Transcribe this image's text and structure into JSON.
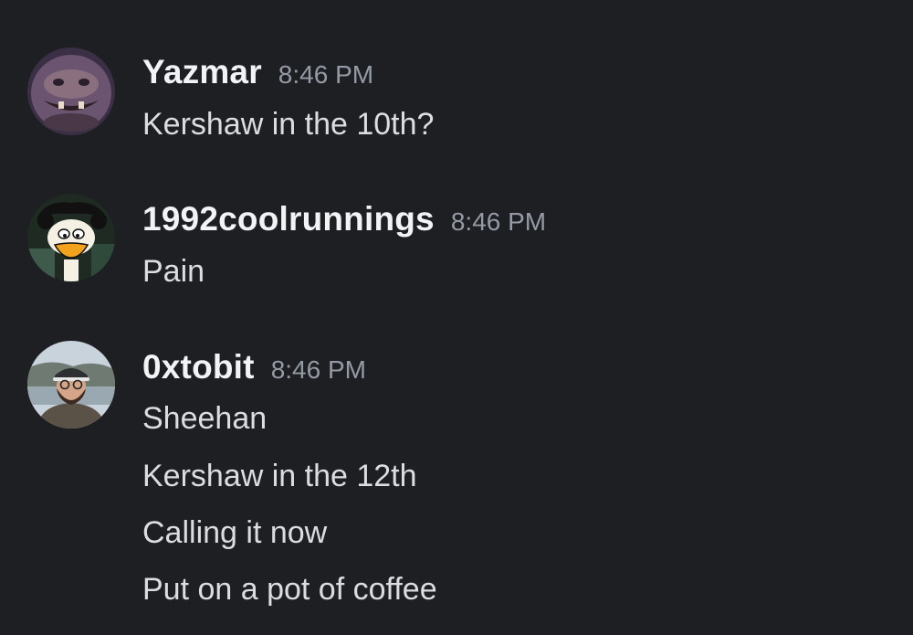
{
  "messages": [
    {
      "username": "Yazmar",
      "timestamp": "8:46 PM",
      "avatar_icon": "creature-face-avatar",
      "lines": [
        "Kershaw in the 10th?"
      ]
    },
    {
      "username": "1992coolrunnings",
      "timestamp": "8:46 PM",
      "avatar_icon": "cartoon-duck-avatar",
      "lines": [
        "Pain"
      ]
    },
    {
      "username": "0xtobit",
      "timestamp": "8:46 PM",
      "avatar_icon": "man-with-cap-photo-avatar",
      "lines": [
        "Sheehan",
        "Kershaw in the 12th",
        "Calling it now",
        "Put on a pot of coffee"
      ]
    }
  ],
  "colors": {
    "background": "#1e1f23",
    "username": "#f2f3f5",
    "timestamp": "#949ba4",
    "message_text": "#dbdee1"
  }
}
